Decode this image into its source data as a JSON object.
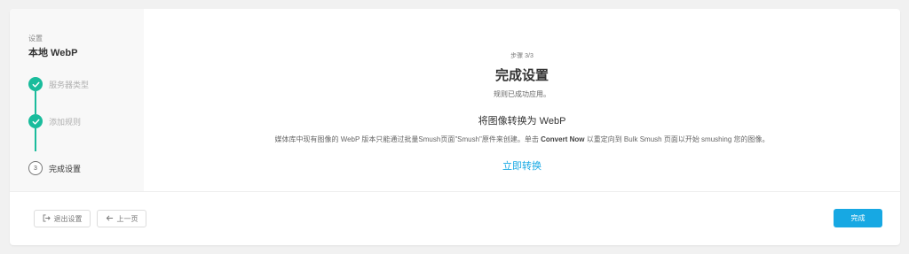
{
  "sidebar": {
    "label": "设置",
    "title": "本地 WebP",
    "steps": [
      {
        "label": "服务器类型",
        "state": "done"
      },
      {
        "label": "添加规则",
        "state": "done"
      },
      {
        "label": "完成设置",
        "state": "current",
        "number": "3"
      }
    ]
  },
  "main": {
    "step_count": "步骤 3/3",
    "heading": "完成设置",
    "subtitle": "规则已成功应用。",
    "section_title": "将图像转换为 WebP",
    "description_part1": "媒体库中现有图像的 WebP 版本只能通过批量Smush页面\"Smush\"原件来创建。单击 ",
    "description_strong": "Convert Now",
    "description_part2": " 以重定向到 Bulk Smush 页面以开始 smushing 您的图像。",
    "convert_link": "立即转换"
  },
  "footer": {
    "exit_label": "退出设置",
    "prev_label": "上一页",
    "finish_label": "完成"
  },
  "colors": {
    "accent": "#17a8e3",
    "success": "#1abc9c"
  },
  "icons": {
    "step_done": "check-icon",
    "exit": "exit-icon",
    "prev": "arrow-left-icon"
  }
}
